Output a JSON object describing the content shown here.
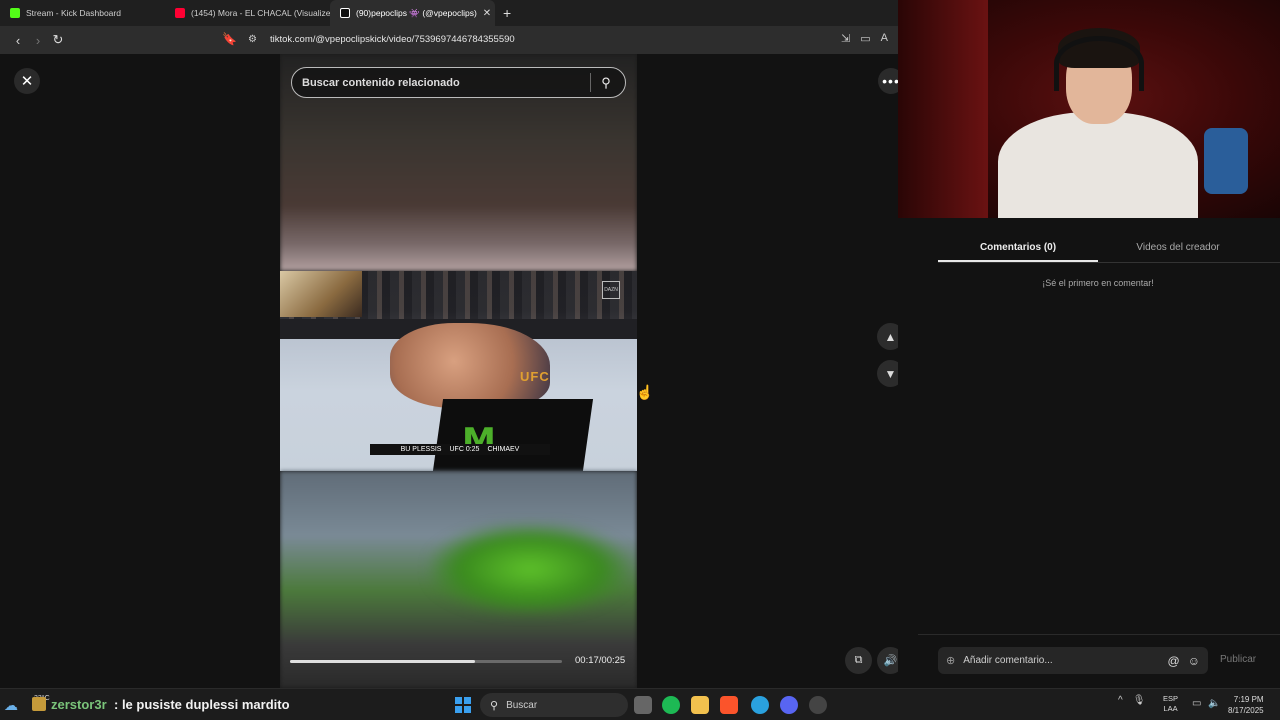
{
  "browser": {
    "tabs": [
      {
        "label": "Stream - Kick Dashboard",
        "color": "#53fc18",
        "active": false
      },
      {
        "label": "(1454) Mora - EL CHACAL (Visualizer)",
        "color": "#ff0033",
        "active": false
      },
      {
        "label": "(90)pepoclips 👾 (@vpepoclips)",
        "color": "#ffffff",
        "active": true
      }
    ],
    "new_tab": "+",
    "url": "tiktok.com/@vpepoclipskick/video/7539697446784355590"
  },
  "page": {
    "search_placeholder": "Buscar contenido relacionado",
    "close_icon": "close-icon",
    "more_icon": "more-icon",
    "video_time": "00:17/00:25",
    "progress_fraction": 0.68,
    "scorebug": {
      "left": "BU PLESSIS",
      "center": "UFC 0:25",
      "right": "CHIMAEV"
    },
    "ufc_text": "UFC",
    "dazn_logo": "DAZN"
  },
  "panel": {
    "tabs": [
      "Comentarios (0)",
      "Videos del creador"
    ],
    "active_tab": 0,
    "empty_text": "¡Sé el primero en comentar!",
    "comment_placeholder": "Añadir comentario...",
    "publish_label": "Publicar"
  },
  "overlay_chat": {
    "username": "zerstor3r",
    "message": ": le pusiste duplessi mardito"
  },
  "taskbar": {
    "weather_temp": "33°C",
    "search_label": "Buscar",
    "lang_line1": "ESP",
    "lang_line2": "LAA",
    "time": "7:19 PM",
    "date": "8/17/2025"
  }
}
